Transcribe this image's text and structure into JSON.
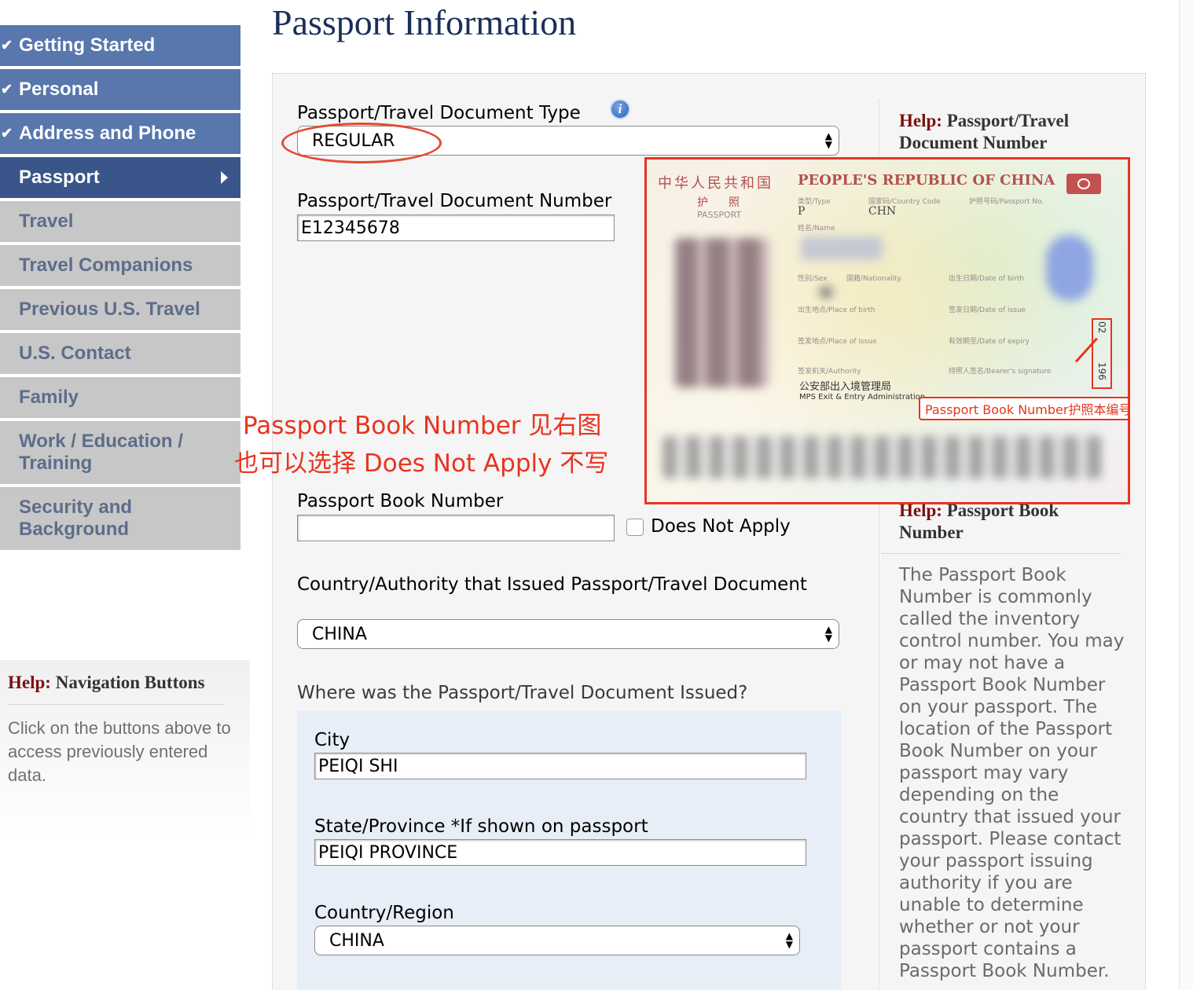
{
  "page_title": "Passport Information",
  "nav": {
    "items": [
      {
        "label": "Getting Started",
        "state": "done"
      },
      {
        "label": "Personal",
        "state": "done"
      },
      {
        "label": "Address and Phone",
        "state": "done"
      },
      {
        "label": "Passport",
        "state": "current"
      },
      {
        "label": "Travel",
        "state": "todo"
      },
      {
        "label": "Travel Companions",
        "state": "todo"
      },
      {
        "label": "Previous U.S. Travel",
        "state": "todo"
      },
      {
        "label": "U.S. Contact",
        "state": "todo"
      },
      {
        "label": "Family",
        "state": "todo"
      },
      {
        "label": "Work / Education / Training",
        "state": "todo"
      },
      {
        "label": "Security and Background",
        "state": "todo"
      }
    ],
    "help_word": "Help:",
    "help_title": "Navigation Buttons",
    "help_text": "Click on the buttons above to access previously entered data."
  },
  "form": {
    "doc_type_label": "Passport/Travel Document Type",
    "doc_type_value": "REGULAR",
    "doc_number_label": "Passport/Travel Document Number",
    "doc_number_value": "E12345678",
    "book_number_label": "Passport Book Number",
    "book_number_value": "",
    "does_not_apply_label": "Does Not Apply",
    "does_not_apply_checked": false,
    "issuing_country_label": "Country/Authority that Issued Passport/Travel Document",
    "issuing_country_value": "CHINA",
    "issued_where_label": "Where was the Passport/Travel Document Issued?",
    "city_label": "City",
    "city_value": "PEIQI SHI",
    "state_label": "State/Province *If shown on passport",
    "state_value": "PEIQI PROVINCE",
    "country_region_label": "Country/Region",
    "country_region_value": "CHINA"
  },
  "annotation": {
    "line1": "Passport Book Number 见右图",
    "line2": "也可以选择 Does Not Apply 不写",
    "image_label": "Passport Book Number护照本编号",
    "color": "#e8341f"
  },
  "passport_image": {
    "country_cn": "中华人民共和国",
    "country_en": "PEOPLE'S REPUBLIC OF CHINA",
    "doc_cn": "护　照",
    "doc_en": "PASSPORT",
    "type_label": "类型/Type",
    "type_value": "P",
    "code_label": "国家码/Country Code",
    "code_value": "CHN",
    "no_label": "护照号码/Passport No.",
    "name_label": "姓名/Name",
    "sex_label": "性别/Sex",
    "nationality_label": "国籍/Nationality",
    "dob_label": "出生日期/Date of birth",
    "pob_label": "出生地点/Place of birth",
    "doi_label": "签发日期/Date of issue",
    "poi_label": "签发地点/Place of issue",
    "doe_label": "有效期至/Date of expiry",
    "authority_label": "签发机关/Authority",
    "signature_label": "持照人签名/Bearer's signature",
    "authority_cn": "公安部出入境管理局",
    "authority_en": "MPS Exit & Entry Administration",
    "book_digits_top": "02",
    "book_digits_bottom": "196"
  },
  "help": {
    "help_word": "Help:",
    "doc_number_title": "Passport/Travel Document Number",
    "book_number_title": "Passport Book Number",
    "book_number_text": "The Passport Book Number is commonly called the inventory control number. You may or may not have a Passport Book Number on your passport. The location of the Passport Book Number on your passport may vary depending on the country that issued your passport. Please contact your passport issuing authority if you are unable to determine whether or not your passport contains a Passport Book Number."
  }
}
